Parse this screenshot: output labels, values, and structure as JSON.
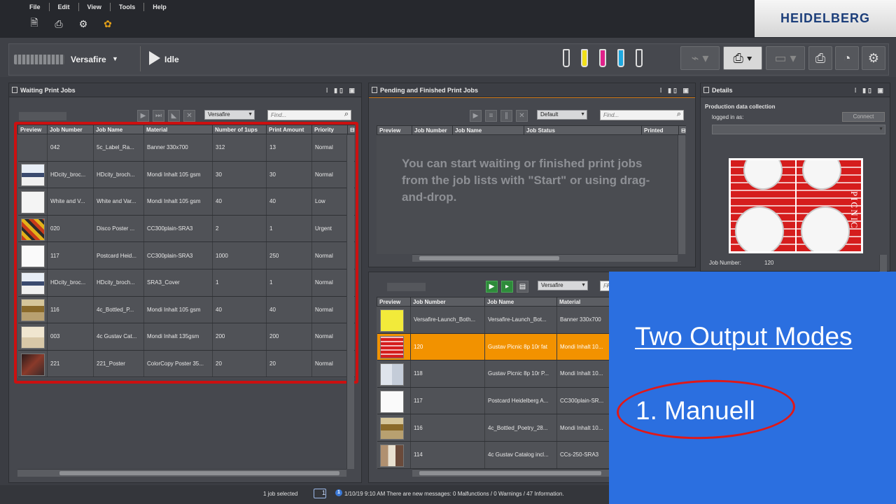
{
  "menu": [
    "File",
    "Edit",
    "View",
    "Tools",
    "Help"
  ],
  "brand": "HEIDELBERG",
  "device": {
    "name": "Versafire",
    "status": "Idle"
  },
  "waiting": {
    "title": "Waiting Print Jobs",
    "filter_select": "Versafire",
    "find_placeholder": "Find...",
    "columns": [
      "Preview",
      "Job Number",
      "Job Name",
      "Material",
      "Number of 1ups",
      "Priority"
    ],
    "columns_full": [
      "Preview",
      "Job Number",
      "Job Name",
      "Material",
      "Number of 1ups",
      "Print Amount",
      "Priority"
    ],
    "rows": [
      {
        "job": "042",
        "name": "5c_Label_Ra...",
        "material": "Banner 330x700",
        "ups": "312",
        "amount": "13",
        "priority": "Normal"
      },
      {
        "job": "HDcity_broc...",
        "name": "HDcity_broch...",
        "material": "Mondi Inhalt 105 gsm",
        "ups": "30",
        "amount": "30",
        "priority": "Normal"
      },
      {
        "job": "White and V...",
        "name": "White and Var...",
        "material": "Mondi Inhalt 105 gsm",
        "ups": "40",
        "amount": "40",
        "priority": "Low"
      },
      {
        "job": "020",
        "name": "Disco Poster ...",
        "material": "CC300plain-SRA3",
        "ups": "2",
        "amount": "1",
        "priority": "Urgent"
      },
      {
        "job": "117",
        "name": "Postcard Heid...",
        "material": "CC300plain-SRA3",
        "ups": "1000",
        "amount": "250",
        "priority": "Normal"
      },
      {
        "job": "HDcity_broc...",
        "name": "HDcity_broch...",
        "material": "SRA3_Cover",
        "ups": "1",
        "amount": "1",
        "priority": "Normal"
      },
      {
        "job": "116",
        "name": "4c_Bottled_P...",
        "material": "Mondi Inhalt 105 gsm",
        "ups": "40",
        "amount": "40",
        "priority": "Normal"
      },
      {
        "job": "003",
        "name": "4c Gustav Cat...",
        "material": "Mondi Inhalt 135gsm",
        "ups": "200",
        "amount": "200",
        "priority": "Normal"
      },
      {
        "job": "221",
        "name": "221_Poster",
        "material": "ColorCopy Poster 35...",
        "ups": "20",
        "amount": "20",
        "priority": "Normal"
      }
    ]
  },
  "pending": {
    "title": "Pending and Finished Print Jobs",
    "filter_select": "Default",
    "find_placeholder": "Find...",
    "columns": [
      "Preview",
      "Job Number",
      "Job Name",
      "Job Status",
      "Printed"
    ],
    "empty_message": "You can start waiting or finished print jobs from the job lists with \"Start\" or using drag-and-drop."
  },
  "finished": {
    "filter_select": "Versafire",
    "find_placeholder": "Fi",
    "columns": [
      "Preview",
      "Job Number",
      "Job Name",
      "Material"
    ],
    "rows": [
      {
        "job": "Versafire-Launch_Both...",
        "name": "Versafire-Launch_Bot...",
        "material": "Banner 330x700"
      },
      {
        "job": "120",
        "name": "Gustav Picnic 8p 10r fat",
        "material": "Mondi Inhalt 10..."
      },
      {
        "job": "118",
        "name": "Gustav Picnic 8p 10r P...",
        "material": "Mondi Inhalt 10..."
      },
      {
        "job": "117",
        "name": "Postcard Heidelberg A...",
        "material": "CC300plain-SR..."
      },
      {
        "job": "116",
        "name": "4c_Bottled_Poetry_28...",
        "material": "Mondi Inhalt 10..."
      },
      {
        "job": "114",
        "name": "4c Gustav Catalog incl...",
        "material": "CCs-250-SRA3"
      }
    ]
  },
  "details": {
    "title": "Details",
    "section": "Production data collection",
    "logged_in_label": "logged in as:",
    "connect_label": "Connect",
    "job_number_label": "Job Number:",
    "job_number_value": "120",
    "preview_text": "PICNIC"
  },
  "status": {
    "selection": "1 job selected",
    "badge": "1",
    "info_badge": "1",
    "message": "1/10/19 9:10 AM  There are new messages: 0 Malfunctions / 0 Warnings / 47 Information."
  },
  "overlay": {
    "title": "Two Output Modes",
    "item": "1. Manuell"
  },
  "colors": {
    "accent_orange": "#f29200",
    "highlight_red": "#cc1010",
    "overlay_blue": "#2b6fe0",
    "ink_yellow": "#f2e01a",
    "ink_magenta": "#e0208a",
    "ink_cyan": "#1ea8e0"
  }
}
